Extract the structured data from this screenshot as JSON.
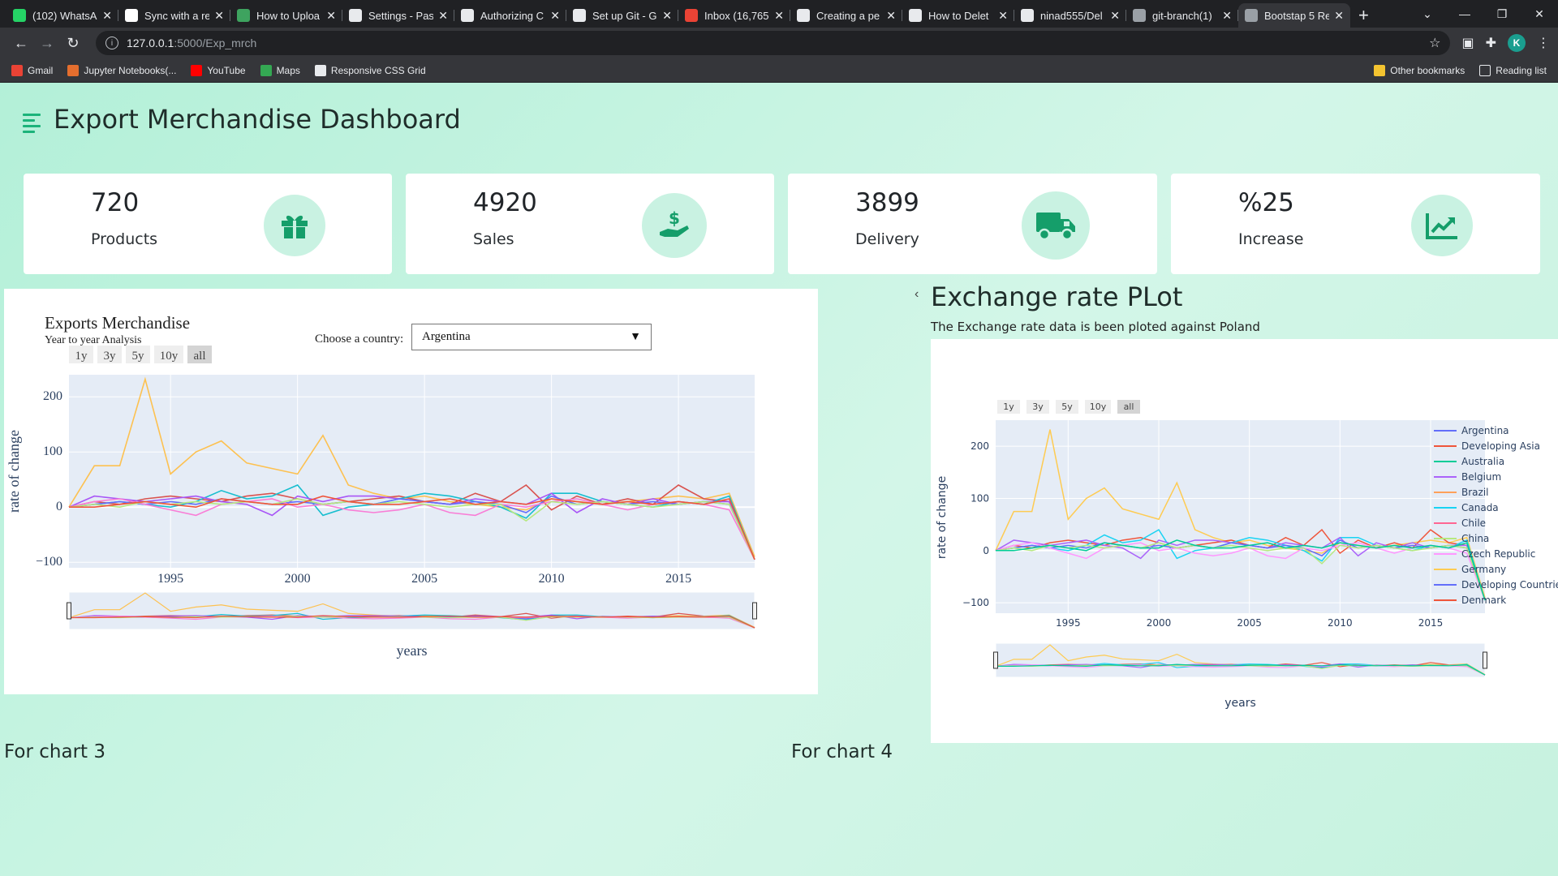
{
  "browser": {
    "tabs": [
      {
        "title": "(102) WhatsA",
        "icon": "whatsapp-icon",
        "color": "#25d366"
      },
      {
        "title": "Sync with a re",
        "icon": "jetbrains-icon",
        "color": "#ffffff"
      },
      {
        "title": "How to Uploa",
        "icon": "link-icon",
        "color": "#3ea35f"
      },
      {
        "title": "Settings - Pas",
        "icon": "gear-icon",
        "color": "#e8eaed"
      },
      {
        "title": "Authorizing C",
        "icon": "github-icon",
        "color": "#e8eaed"
      },
      {
        "title": "Set up Git - G",
        "icon": "github-icon",
        "color": "#e8eaed"
      },
      {
        "title": "Inbox (16,765",
        "icon": "gmail-icon",
        "color": "#ea4335"
      },
      {
        "title": "Creating a pe",
        "icon": "github-icon",
        "color": "#e8eaed"
      },
      {
        "title": "How to Delet",
        "icon": "dev-icon",
        "color": "#e8eaed"
      },
      {
        "title": "ninad555/Del",
        "icon": "github-icon",
        "color": "#e8eaed"
      },
      {
        "title": "git-branch(1)",
        "icon": "globe-icon",
        "color": "#9aa0a6"
      },
      {
        "title": "Bootstap 5 Re",
        "icon": "globe-icon",
        "color": "#9aa0a6"
      }
    ],
    "active_tab_index": 11,
    "new_tab": "+",
    "url_host": "127.0.0.1",
    "url_path": ":5000/Exp_mrch",
    "avatar_letter": "K",
    "bookmarks": [
      {
        "label": "Gmail",
        "icon": "gmail-icon"
      },
      {
        "label": "Jupyter Notebooks(...",
        "icon": "jupyter-icon"
      },
      {
        "label": "YouTube",
        "icon": "youtube-icon"
      },
      {
        "label": "Maps",
        "icon": "maps-icon"
      },
      {
        "label": "Responsive CSS Grid",
        "icon": "grid-icon"
      }
    ],
    "other_bookmarks": "Other bookmarks",
    "reading_list": "Reading list"
  },
  "page": {
    "title": "Export Merchandise Dashboard",
    "accent": "#1bb37a",
    "cards": [
      {
        "value": "720",
        "label": "Products",
        "icon": "gift-icon"
      },
      {
        "value": "4920",
        "label": "Sales",
        "icon": "dollar-hand-icon"
      },
      {
        "value": "3899",
        "label": "Delivery",
        "icon": "truck-icon"
      },
      {
        "value": "%25",
        "label": "Increase",
        "icon": "chart-line-icon"
      }
    ],
    "chart1": {
      "title": "Exports Merchandise",
      "subtitle": "Year to year Analysis",
      "choose_label": "Choose a country:",
      "selected_country": "Argentina",
      "range_buttons": [
        "1y",
        "3y",
        "5y",
        "10y",
        "all"
      ],
      "active_range": "all",
      "ylabel": "rate of change",
      "xlabel": "years"
    },
    "chart2": {
      "title": "Exchange rate PLot",
      "description": "The Exchange rate data is been ploted against Poland",
      "range_buttons": [
        "1y",
        "3y",
        "5y",
        "10y",
        "all"
      ],
      "active_range": "all",
      "ylabel": "rate of change",
      "xlabel": "years"
    },
    "footer_left": "For chart 3",
    "footer_right": "For chart 4"
  },
  "chart_data": [
    {
      "type": "line",
      "title": "Exports Merchandise",
      "subtitle": "Year to year Analysis",
      "xlabel": "years",
      "ylabel": "rate of change",
      "xlim": [
        1991,
        2018
      ],
      "ylim": [
        -110,
        240
      ],
      "xticks": [
        1995,
        2000,
        2005,
        2010,
        2015
      ],
      "yticks": [
        -100,
        0,
        100,
        200
      ],
      "x": [
        1991,
        1992,
        1993,
        1994,
        1995,
        1996,
        1997,
        1998,
        1999,
        2000,
        2001,
        2002,
        2003,
        2004,
        2005,
        2006,
        2007,
        2008,
        2009,
        2010,
        2011,
        2012,
        2013,
        2014,
        2015,
        2016,
        2017,
        2018
      ],
      "series": [
        {
          "color": "#fdc150",
          "values": [
            0,
            75,
            75,
            232,
            60,
            100,
            120,
            80,
            70,
            60,
            130,
            40,
            25,
            15,
            20,
            10,
            5,
            0,
            -5,
            15,
            10,
            5,
            10,
            15,
            20,
            15,
            25,
            -90
          ]
        },
        {
          "color": "#d9534f",
          "values": [
            0,
            10,
            5,
            15,
            20,
            15,
            10,
            20,
            25,
            15,
            5,
            10,
            15,
            20,
            10,
            5,
            25,
            10,
            40,
            -5,
            20,
            5,
            15,
            5,
            40,
            15,
            10,
            -95
          ]
        },
        {
          "color": "#17becf",
          "values": [
            0,
            5,
            10,
            5,
            0,
            10,
            30,
            15,
            20,
            40,
            -15,
            0,
            5,
            15,
            25,
            20,
            10,
            0,
            -20,
            25,
            25,
            10,
            5,
            0,
            10,
            5,
            20,
            -95
          ]
        },
        {
          "color": "#a855f7",
          "values": [
            0,
            20,
            15,
            10,
            15,
            20,
            10,
            5,
            -15,
            20,
            10,
            20,
            20,
            15,
            10,
            5,
            15,
            10,
            5,
            25,
            -10,
            15,
            5,
            15,
            5,
            10,
            10,
            -95
          ]
        },
        {
          "color": "#636efa",
          "values": [
            0,
            5,
            10,
            5,
            10,
            5,
            15,
            10,
            5,
            10,
            5,
            10,
            5,
            15,
            10,
            5,
            10,
            5,
            -10,
            20,
            5,
            10,
            5,
            10,
            5,
            10,
            5,
            -95
          ]
        },
        {
          "color": "#f97dd6",
          "values": [
            0,
            10,
            15,
            5,
            -5,
            -15,
            5,
            10,
            15,
            0,
            5,
            -5,
            -10,
            -5,
            5,
            -10,
            -15,
            5,
            0,
            10,
            15,
            5,
            -5,
            5,
            10,
            5,
            -5,
            -95
          ]
        },
        {
          "color": "#b6e880",
          "values": [
            0,
            5,
            0,
            10,
            5,
            10,
            5,
            10,
            5,
            15,
            5,
            10,
            5,
            10,
            5,
            0,
            5,
            5,
            -25,
            10,
            5,
            10,
            5,
            0,
            5,
            10,
            5,
            -95
          ]
        },
        {
          "color": "#ef553b",
          "values": [
            0,
            0,
            5,
            10,
            5,
            0,
            15,
            10,
            5,
            5,
            20,
            10,
            5,
            5,
            10,
            15,
            5,
            10,
            5,
            15,
            10,
            5,
            10,
            5,
            10,
            5,
            15,
            -95
          ]
        }
      ]
    },
    {
      "type": "line",
      "title": "Exchange rate PLot",
      "xlabel": "years",
      "ylabel": "rate of change",
      "xlim": [
        1991,
        2018
      ],
      "ylim": [
        -120,
        250
      ],
      "xticks": [
        1995,
        2000,
        2005,
        2010,
        2015
      ],
      "yticks": [
        -100,
        0,
        100,
        200
      ],
      "legend": [
        "Argentina",
        "Developing Asia",
        "Australia",
        "Belgium",
        "Brazil",
        "Canada",
        "Chile",
        "China",
        "Czech Republic",
        "Germany",
        "Developing Countrie",
        "Denmark"
      ],
      "legend_colors": [
        "#636efa",
        "#ef553b",
        "#00cc96",
        "#ab63fa",
        "#ffa15a",
        "#19d3f3",
        "#ff6692",
        "#b6e880",
        "#ff97ff",
        "#fecb52",
        "#636efa",
        "#ef553b"
      ],
      "x": [
        1991,
        1992,
        1993,
        1994,
        1995,
        1996,
        1997,
        1998,
        1999,
        2000,
        2001,
        2002,
        2003,
        2004,
        2005,
        2006,
        2007,
        2008,
        2009,
        2010,
        2011,
        2012,
        2013,
        2014,
        2015,
        2016,
        2017,
        2018
      ],
      "series": [
        {
          "color": "#fecb52",
          "values": [
            0,
            75,
            75,
            232,
            60,
            100,
            120,
            80,
            70,
            60,
            130,
            40,
            25,
            15,
            20,
            10,
            5,
            0,
            -5,
            15,
            10,
            5,
            10,
            15,
            20,
            15,
            25,
            -90
          ]
        },
        {
          "color": "#ef553b",
          "values": [
            0,
            10,
            5,
            15,
            20,
            15,
            10,
            20,
            25,
            15,
            5,
            10,
            15,
            20,
            10,
            5,
            25,
            10,
            40,
            -5,
            20,
            5,
            15,
            5,
            40,
            15,
            10,
            -95
          ]
        },
        {
          "color": "#19d3f3",
          "values": [
            0,
            5,
            10,
            5,
            0,
            10,
            30,
            15,
            20,
            40,
            -15,
            0,
            5,
            15,
            25,
            20,
            10,
            0,
            -20,
            25,
            25,
            10,
            5,
            0,
            10,
            5,
            20,
            -95
          ]
        },
        {
          "color": "#ab63fa",
          "values": [
            0,
            20,
            15,
            10,
            15,
            20,
            10,
            5,
            -15,
            20,
            10,
            20,
            20,
            15,
            10,
            5,
            15,
            10,
            5,
            25,
            -10,
            15,
            5,
            15,
            5,
            10,
            10,
            -95
          ]
        },
        {
          "color": "#636efa",
          "values": [
            0,
            5,
            10,
            5,
            10,
            5,
            15,
            10,
            5,
            10,
            5,
            10,
            5,
            15,
            10,
            5,
            10,
            5,
            -10,
            20,
            5,
            10,
            5,
            10,
            5,
            10,
            5,
            -95
          ]
        },
        {
          "color": "#ff97ff",
          "values": [
            0,
            10,
            15,
            5,
            -5,
            -15,
            5,
            10,
            15,
            0,
            5,
            -5,
            -10,
            -5,
            5,
            -10,
            -15,
            5,
            0,
            10,
            15,
            5,
            -5,
            5,
            10,
            5,
            -5,
            -95
          ]
        },
        {
          "color": "#b6e880",
          "values": [
            0,
            5,
            0,
            10,
            5,
            10,
            5,
            10,
            5,
            15,
            5,
            10,
            5,
            10,
            5,
            0,
            5,
            5,
            -25,
            10,
            5,
            10,
            5,
            0,
            5,
            10,
            5,
            -95
          ]
        },
        {
          "color": "#00cc96",
          "values": [
            0,
            0,
            5,
            10,
            5,
            0,
            15,
            10,
            5,
            5,
            20,
            10,
            5,
            5,
            10,
            15,
            5,
            10,
            5,
            15,
            10,
            5,
            10,
            5,
            10,
            5,
            15,
            -95
          ]
        }
      ]
    }
  ]
}
